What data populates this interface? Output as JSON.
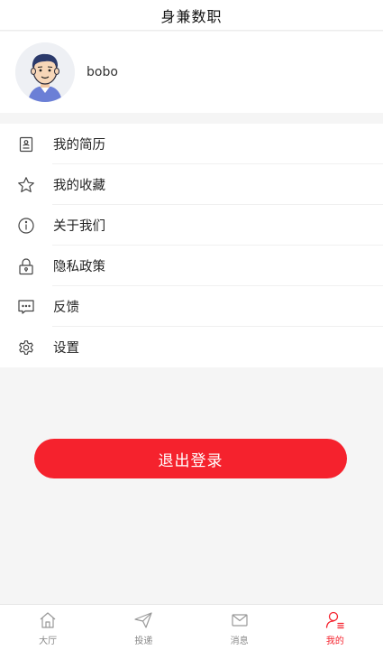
{
  "header": {
    "title": "身兼数职"
  },
  "profile": {
    "username": "bobo",
    "avatar_icon": "user-avatar"
  },
  "menu": {
    "items": [
      {
        "label": "我的简历",
        "icon": "resume-icon"
      },
      {
        "label": "我的收藏",
        "icon": "star-icon"
      },
      {
        "label": "关于我们",
        "icon": "info-icon"
      },
      {
        "label": "隐私政策",
        "icon": "lock-icon"
      },
      {
        "label": "反馈",
        "icon": "feedback-icon"
      },
      {
        "label": "设置",
        "icon": "gear-icon"
      }
    ]
  },
  "logout": {
    "label": "退出登录",
    "color": "#f5222d"
  },
  "tabbar": {
    "active_color": "#f5222d",
    "tabs": [
      {
        "label": "大厅",
        "icon": "home-icon",
        "active": false
      },
      {
        "label": "投递",
        "icon": "send-icon",
        "active": false
      },
      {
        "label": "消息",
        "icon": "mail-icon",
        "active": false
      },
      {
        "label": "我的",
        "icon": "user-icon",
        "active": true
      }
    ]
  }
}
